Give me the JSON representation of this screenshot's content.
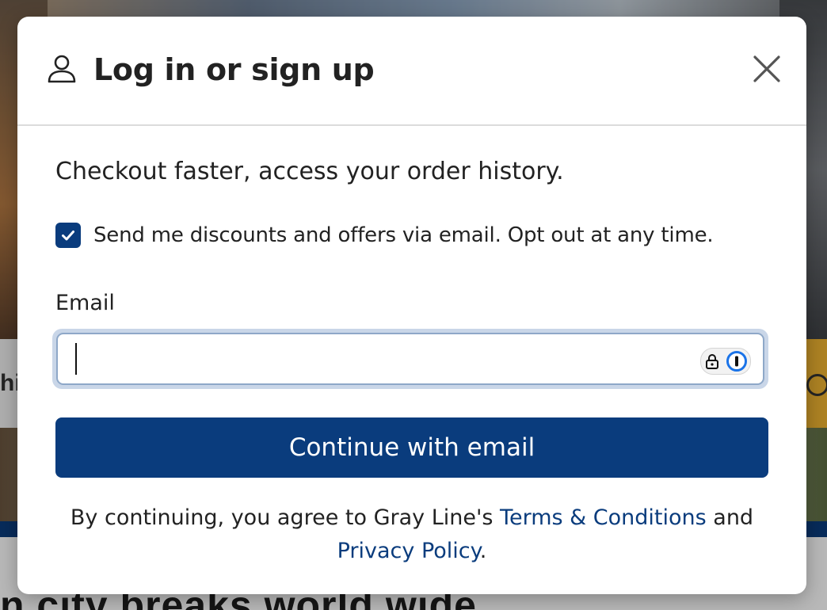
{
  "background": {
    "search_partial_text": "hi",
    "heading_partial": "n city breaks world wide"
  },
  "modal": {
    "title": "Log in or sign up",
    "icons": {
      "user": "user-icon",
      "close": "close-icon",
      "check": "checkmark-icon",
      "password_manager": "password-manager-icon"
    },
    "intro": "Checkout faster, access your order history.",
    "optin": {
      "checked": true,
      "label": "Send me discounts and offers via email. Opt out at any time."
    },
    "email": {
      "label": "Email",
      "value": "",
      "placeholder": ""
    },
    "continue_label": "Continue with email",
    "legal": {
      "prefix": "By continuing, you agree to Gray Line's ",
      "terms_link": "Terms & Conditions",
      "middle": " and",
      "privacy_link": "Privacy Policy",
      "suffix": "."
    }
  },
  "colors": {
    "primary": "#0a3c7d",
    "text": "#222222",
    "divider": "#dcdcdc",
    "focus_ring": "#c9d6e8"
  }
}
